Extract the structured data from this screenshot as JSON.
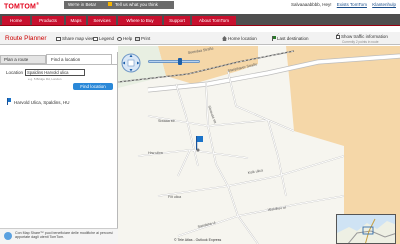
{
  "header": {
    "logo": "TOMTOM",
    "beta_notice": "We're in Beta!",
    "feedback": "Tell us what you think",
    "user_greeting": "Salvaaaabbbb, Hey!",
    "logout_link": "Exists TomTom",
    "help_link": "Klantenhulp"
  },
  "nav": {
    "items": [
      {
        "label": "Home"
      },
      {
        "label": "Products"
      },
      {
        "label": "Maps"
      },
      {
        "label": "Services"
      },
      {
        "label": "Where to Buy"
      },
      {
        "label": "Support"
      },
      {
        "label": "About TomTom"
      }
    ]
  },
  "toolbar": {
    "title": "Route Planner",
    "share": "Share map view",
    "legend": "Legend",
    "help": "Help",
    "print": "Print",
    "home_location": "Home location",
    "last_destination": "Last destination",
    "traffic": "Show traffic information",
    "traffic_sub": "Currently 2 points in route"
  },
  "left_panel": {
    "tab_plan": "Plan a route",
    "tab_find": "Find a location",
    "location_label": "Location",
    "location_value": "Spaldins Harvold ulica",
    "hint": "e.g. 5 Bridge Rd, London",
    "find_button": "Find location",
    "result": "Harvold Ulica, Spaldins, HU",
    "promo_text": "Con Map Share™ puoi beneficiare delle modifiche ai percorsi apportate dagli utenti TomTom."
  },
  "map": {
    "copyright": "© Tele Atlas - Outlook Express",
    "labels": [
      "Stariphaver Straße",
      "Seeedaa Straße",
      "Sbrauaa str.",
      "Siwaaa str",
      "Hrw ulica",
      "Fllt ulica",
      "Kolk ulica",
      "Wolvikov ul",
      "Sandaha ul"
    ]
  },
  "colors": {
    "brand_red": "#c8102e",
    "nav_bg": "#4e4e4e",
    "map_bg": "#f6f5ef",
    "map_zone": "#f5d7a8",
    "accent_blue": "#2a88d8"
  }
}
